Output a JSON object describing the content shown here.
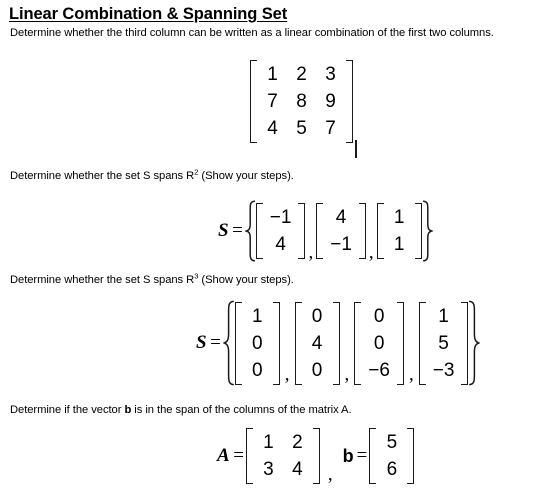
{
  "title": "Linear Combination & Spanning Set",
  "problems": [
    {
      "prompt_parts": [
        {
          "t": "Determine whether the third column can be written as a linear combination of the first two columns."
        }
      ],
      "matrix": {
        "rows": [
          [
            "1",
            "2",
            "3"
          ],
          [
            "7",
            "8",
            "9"
          ],
          [
            "4",
            "5",
            "7"
          ]
        ]
      }
    },
    {
      "prompt_parts": [
        {
          "t": "Determine whether the set S spans R"
        },
        {
          "t": "2",
          "sup": true
        },
        {
          "t": " (Show your steps)."
        }
      ],
      "set_label": "S",
      "equals": "=",
      "vectors": [
        [
          "−1",
          "4"
        ],
        [
          "4",
          "−1"
        ],
        [
          "1",
          "1"
        ]
      ]
    },
    {
      "prompt_parts": [
        {
          "t": "Determine whether the set S spans R"
        },
        {
          "t": "3",
          "sup": true
        },
        {
          "t": " (Show your steps)."
        }
      ],
      "set_label": "S",
      "equals": "=",
      "vectors": [
        [
          "1",
          "0",
          "0"
        ],
        [
          "0",
          "4",
          "0"
        ],
        [
          "0",
          "0",
          "−6"
        ],
        [
          "1",
          "5",
          "−3"
        ]
      ]
    },
    {
      "prompt_parts": [
        {
          "t": "Determine if the vector "
        },
        {
          "t": "b",
          "bold": true
        },
        {
          "t": " is in the span of the columns of the matrix A."
        }
      ],
      "a_label": "A",
      "a_equals": "=",
      "a_matrix": [
        [
          "1",
          "2"
        ],
        [
          "3",
          "4"
        ]
      ],
      "separator": ",",
      "b_label": "b",
      "b_equals": "=",
      "b_matrix": [
        [
          "5"
        ],
        [
          "6"
        ]
      ]
    }
  ],
  "colors": {
    "text": "#000000",
    "ink": "#1a1a1a",
    "background": "#ffffff"
  }
}
